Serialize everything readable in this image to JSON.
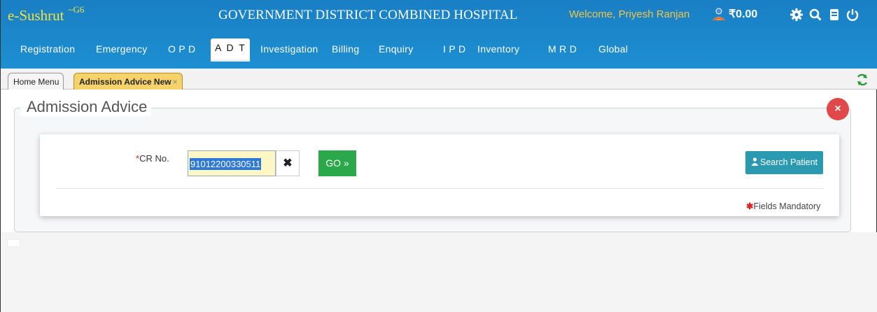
{
  "header": {
    "brand": "e-Sushrut",
    "brand_sup": "~G6",
    "hospital": "GOVERNMENT DISTRICT COMBINED HOSPITAL",
    "welcome": "Welcome, Priyesh Ranjan",
    "balance": "₹0.00",
    "icons": [
      "user-avatar-icon",
      "gear-icon",
      "search-icon",
      "book-icon",
      "power-icon"
    ],
    "background": "#1a7fc4",
    "brand_color": "#f3e23b",
    "welcome_color": "#f5c542"
  },
  "menu": {
    "items": [
      "Registration",
      "Emergency",
      "O P D",
      "A D T",
      "Investigation",
      "Billing",
      "Enquiry",
      "I P D",
      "Inventory",
      "M R D",
      "Global"
    ],
    "active": "A D T"
  },
  "tabs": {
    "home": "Home Menu",
    "active": "Admission Advice New",
    "close": "×"
  },
  "page": {
    "legend": "Admission Advice",
    "close_symbol": "×",
    "cr_label": "CR No.",
    "required_mark": "*",
    "cr_value": "91012200330511",
    "clear_symbol": "✖",
    "go_label": "GO »",
    "search_label": "Search Patient",
    "mandatory_mark": "✱",
    "mandatory_text": "Fields Mandatory",
    "close_color": "#e0484a",
    "go_color": "#2aa84a",
    "search_color": "#2a9ab0"
  }
}
